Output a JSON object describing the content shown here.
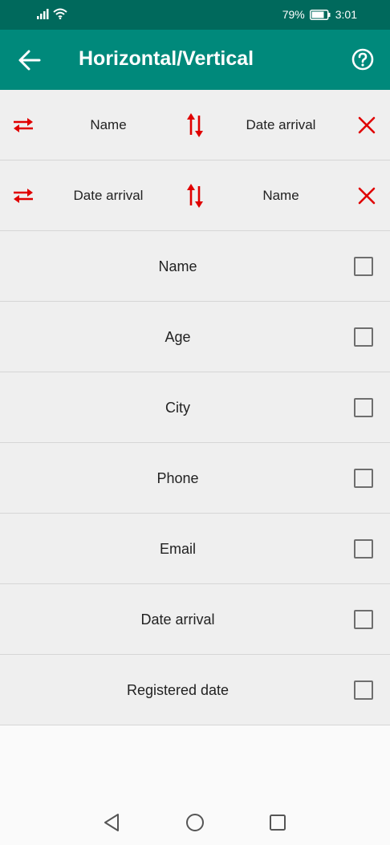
{
  "status_bar": {
    "battery_percent": "79%",
    "time": "3:01",
    "icons": [
      "signal-icon",
      "wifi-icon",
      "battery-icon"
    ]
  },
  "appbar": {
    "title": "Horizontal/Vertical",
    "back_icon": "arrow-left-icon",
    "help_icon": "help-circle-icon"
  },
  "rules": [
    {
      "left": "Name",
      "right": "Date arrival"
    },
    {
      "left": "Date arrival",
      "right": "Name"
    }
  ],
  "fields": [
    {
      "label": "Name",
      "checked": false
    },
    {
      "label": "Age",
      "checked": false
    },
    {
      "label": "City",
      "checked": false
    },
    {
      "label": "Phone",
      "checked": false
    },
    {
      "label": "Email",
      "checked": false
    },
    {
      "label": "Date arrival",
      "checked": false
    },
    {
      "label": "Registered date",
      "checked": false
    }
  ],
  "colors": {
    "status_bar": "#00695c",
    "appbar": "#00897b",
    "accent_red": "#e00000",
    "row_bg": "#efefef"
  },
  "nav_bar": {
    "icons": [
      "back-triangle-icon",
      "home-circle-icon",
      "recents-square-icon"
    ]
  }
}
